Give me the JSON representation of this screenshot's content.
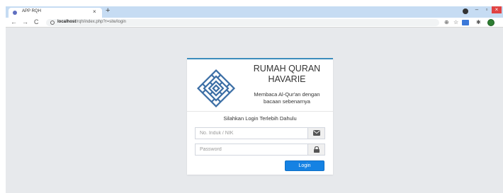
{
  "browser": {
    "tab_title": "APP RQH",
    "tab_close": "×",
    "new_tab": "+",
    "url_host": "localhost",
    "url_path": "/rqh/index.php?r=site/login",
    "nav": {
      "back": "←",
      "forward": "→",
      "reload": "C"
    },
    "toolbar_icons": [
      "zoom-icon",
      "star-icon",
      "extension-icon",
      "puzzle-icon",
      "avatar"
    ],
    "window_buttons": {
      "minimize": "–",
      "maximize": "▫",
      "close": "×"
    }
  },
  "login": {
    "brand_line1": "RUMAH QURAN",
    "brand_line2": "HAVARIE",
    "tagline_line1": "Membaca Al-Qur'an dengan",
    "tagline_line2": "bacaan sebenarnya",
    "prompt": "Silahkan Login Terlebih Dahulu",
    "username_placeholder": "No. Induk / NIK",
    "password_placeholder": "Password",
    "login_button": "Login",
    "accent_color": "#3c8dbc",
    "button_color": "#1582e3"
  }
}
